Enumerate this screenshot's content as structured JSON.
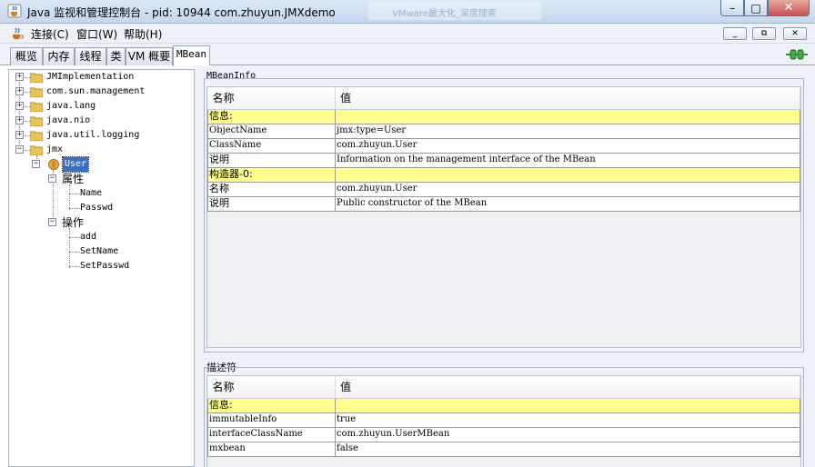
{
  "window": {
    "title": "Java 监视和管理控制台 - pid: 10944 com.zhuyun.JMXdemo",
    "ghost_tab": "VMware最大化_深度搜索",
    "close_glyph": "✕",
    "min_glyph": "–",
    "max_glyph": "□"
  },
  "menubar": {
    "items": [
      "连接(C)",
      "窗口(W)",
      "帮助(H)"
    ],
    "mdi_min": "_",
    "mdi_restore": "⧉",
    "mdi_close": "✕"
  },
  "tabs": {
    "items": [
      "概览",
      "内存",
      "线程",
      "类",
      "VM 概要",
      "MBean"
    ],
    "active": "MBean"
  },
  "tree": {
    "nodes": [
      "JMImplementation",
      "com.sun.management",
      "java.lang",
      "java.nio",
      "java.util.logging",
      "jmx"
    ],
    "selected": "User",
    "attributes_label": "属性",
    "attributes": [
      "Name",
      "Passwd"
    ],
    "operations_label": "操作",
    "operations": [
      "add",
      "SetName",
      "SetPasswd"
    ],
    "plus": "+",
    "minus": "−"
  },
  "mbean_info": {
    "title": "MBeanInfo",
    "col_name": "名称",
    "col_value": "值",
    "rows": [
      {
        "name": "信息:",
        "value": "",
        "highlight": true
      },
      {
        "name": "ObjectName",
        "value": "jmx:type=User"
      },
      {
        "name": "ClassName",
        "value": "com.zhuyun.User"
      },
      {
        "name": "说明",
        "value": "Information on the management interface of the MBean"
      },
      {
        "name": "构造器-0:",
        "value": "",
        "highlight": true
      },
      {
        "name": "名称",
        "value": "com.zhuyun.User"
      },
      {
        "name": "说明",
        "value": "Public constructor of the MBean"
      }
    ]
  },
  "descriptor": {
    "title": "描述符",
    "col_name": "名称",
    "col_value": "值",
    "rows": [
      {
        "name": "信息:",
        "value": "",
        "highlight": true
      },
      {
        "name": "immutableInfo",
        "value": "true"
      },
      {
        "name": "interfaceClassName",
        "value": "com.zhuyun.UserMBean"
      },
      {
        "name": "mxbean",
        "value": "false"
      }
    ]
  },
  "colors": {
    "highlight_row": "#ffff8a",
    "selection": "#3a6fc6",
    "panel_bg": "#eef2f8"
  }
}
